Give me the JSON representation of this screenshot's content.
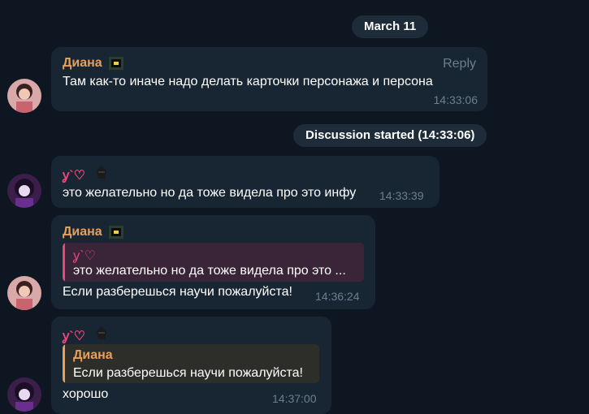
{
  "date_separator": "March 11",
  "discussion_label": "Discussion started (14:33:06)",
  "messages": [
    {
      "sender": "Диана",
      "text": "Там как-то иначе надо делать карточки персонажа и персона",
      "reply_label": "Reply",
      "time": "14:33:06"
    },
    {
      "sender": "ỿ`♡",
      "text": "это желательно но да тоже видела про это инфу",
      "time": "14:33:39"
    },
    {
      "sender": "Диана",
      "quote_sender": "ỿ`♡",
      "quote_text": "это желательно но да тоже видела про это ...",
      "text": "Если разберешься научи пожалуйста!",
      "time": "14:36:24"
    },
    {
      "sender": "ỿ`♡",
      "quote_sender": "Диана",
      "quote_text": "Если разберешься научи пожалуйста!",
      "text": "хорошо",
      "time": "14:37:00"
    }
  ],
  "colors": {
    "background": "#0e1621",
    "bubble": "#182533",
    "orange_name": "#e7a05a",
    "pink_name": "#e9477a"
  },
  "icons": [
    "sticker-icon",
    "avatar"
  ]
}
